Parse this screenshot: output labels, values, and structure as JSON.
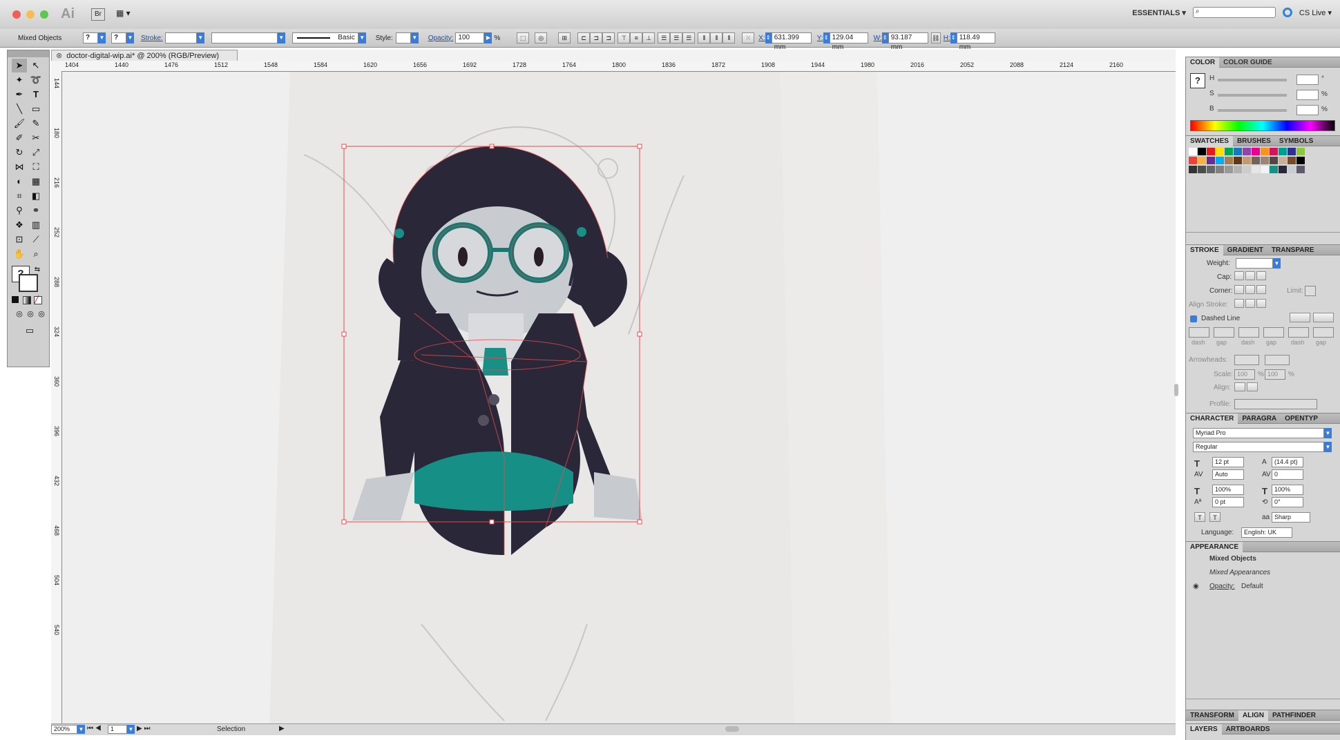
{
  "app": {
    "logo": "Ai",
    "bridge": "Br",
    "workspace": "ESSENTIALS",
    "cs_live": "CS Live"
  },
  "control": {
    "selection_label": "Mixed Objects",
    "fill_value": "?",
    "stroke_value": "?",
    "stroke_label": "Stroke:",
    "brush_label": "Basic",
    "style_label": "Style:",
    "opacity_label": "Opacity:",
    "opacity_value": "100",
    "opacity_unit": "%",
    "x_label": "X:",
    "x_value": "631.399 mm",
    "y_label": "Y:",
    "y_value": "129.04 mm",
    "w_label": "W:",
    "w_value": "93.187 mm",
    "h_label": "H:",
    "h_value": "118.49 mm"
  },
  "document": {
    "tab_title": "doctor-digital-wip.ai* @ 200% (RGB/Preview)",
    "ruler_h": [
      "1404",
      "1440",
      "1476",
      "1512",
      "1548",
      "1584",
      "1620",
      "1656",
      "1692",
      "1728",
      "1764",
      "1800",
      "1836",
      "1872",
      "1908",
      "1944",
      "1980",
      "2016",
      "2052",
      "2088",
      "2124",
      "2160"
    ],
    "ruler_v": [
      "144",
      "180",
      "216",
      "252",
      "288",
      "324",
      "360",
      "396",
      "432",
      "468",
      "504",
      "540"
    ]
  },
  "status": {
    "zoom": "200%",
    "artboard": "1",
    "mode": "Selection"
  },
  "panels": {
    "color": {
      "tab1": "COLOR",
      "tab2": "COLOR GUIDE",
      "h_label": "H",
      "s_label": "S",
      "b_label": "B",
      "h_unit": "°",
      "s_unit": "%",
      "b_unit": "%"
    },
    "swatches": {
      "tab1": "SWATCHES",
      "tab2": "BRUSHES",
      "tab3": "SYMBOLS"
    },
    "stroke": {
      "tab1": "STROKE",
      "tab2": "GRADIENT",
      "tab3": "TRANSPARE",
      "weight": "Weight:",
      "cap": "Cap:",
      "corner": "Corner:",
      "limit": "Limit:",
      "align": "Align Stroke:",
      "dashed": "Dashed Line",
      "dash": "dash",
      "gap": "gap",
      "arrowheads": "Arrowheads:",
      "scale": "Scale:",
      "scale1": "100",
      "scale2": "100",
      "pct": "%",
      "align2": "Align:",
      "profile": "Profile:"
    },
    "character": {
      "tab1": "CHARACTER",
      "tab2": "PARAGRA",
      "tab3": "OPENTYP",
      "font": "Myriad Pro",
      "style": "Regular",
      "size": "12 pt",
      "leading": "(14.4 pt)",
      "kerning": "Auto",
      "tracking": "0",
      "vscale": "100%",
      "hscale": "100%",
      "baseline": "0 pt",
      "rotation": "0°",
      "aa_label": "aa",
      "aa": "Sharp",
      "language_label": "Language:",
      "language": "English: UK"
    },
    "appearance": {
      "tab": "APPEARANCE",
      "row1": "Mixed Objects",
      "row2": "Mixed Appearances",
      "opacity_label": "Opacity:",
      "opacity_value": "Default"
    },
    "bottom": {
      "tab1": "TRANSFORM",
      "tab2": "ALIGN",
      "tab3": "PATHFINDER",
      "tab4": "LAYERS",
      "tab5": "ARTBOARDS"
    }
  },
  "colors": {
    "accent": "#3a7cd8",
    "selection": "#e84a4a",
    "hair": "#2a2838",
    "teal": "#1a8f86",
    "skin": "#c9ccd1"
  }
}
